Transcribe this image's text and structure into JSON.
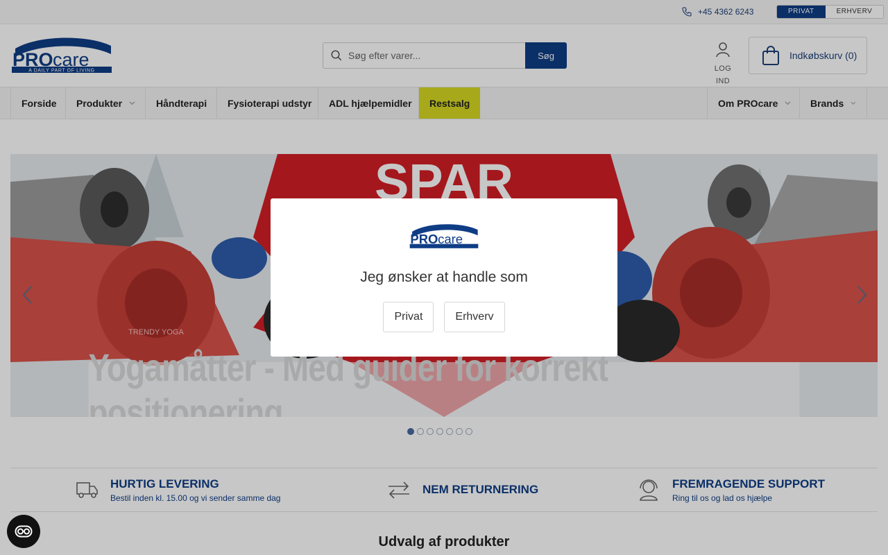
{
  "topbar": {
    "phone": "+45 4362 6243",
    "segments": [
      "PRIVAT",
      "ERHVERV"
    ]
  },
  "header": {
    "logo_text": "PROcare",
    "logo_tagline": "A DAILY PART OF LIVING",
    "search_placeholder": "Søg efter varer...",
    "search_button": "Søg",
    "login_label": "LOG IND",
    "cart_label": "Indkøbskurv (0)"
  },
  "nav": {
    "items": [
      "Forside",
      "Produkter",
      "Håndterapi",
      "Fysioterapi udstyr",
      "ADL hjælpemidler",
      "Restsalg",
      "Om PROcare",
      "Brands"
    ]
  },
  "hero": {
    "banner_word": "SPAR",
    "caption": "Yogamåtter - Med guider for korrekt positionering",
    "mat_brand": "TRENDY YOGA",
    "slide_count": 7,
    "active_slide": 1
  },
  "usps": [
    {
      "title": "HURTIG LEVERING",
      "subtitle": "Bestil inden kl. 15.00 og vi sender samme dag",
      "icon": "truck-icon"
    },
    {
      "title": "NEM RETURNERING",
      "subtitle": "",
      "icon": "return-arrows-icon"
    },
    {
      "title": "FREMRAGENDE SUPPORT",
      "subtitle": "Ring til os og lad os hjælpe",
      "icon": "headset-icon"
    }
  ],
  "section_title": "Udvalg af produkter",
  "modal": {
    "question": "Jeg ønsker at handle som",
    "options": [
      "Privat",
      "Erhverv"
    ]
  },
  "colors": {
    "brand_blue": "#0f3d85",
    "sale_yellow": "#d7d922"
  }
}
